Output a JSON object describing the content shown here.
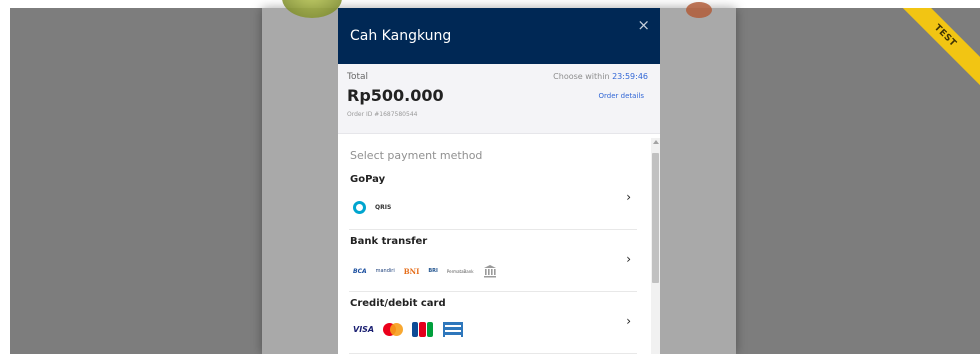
{
  "window": {
    "ribbon_label": "TEST"
  },
  "modal": {
    "merchant_name": "Cah Kangkung",
    "close_glyph": "×"
  },
  "summary": {
    "total_label": "Total",
    "amount": "Rp500.000",
    "order_id": "Order ID #1687580544",
    "countdown_label": "Choose within",
    "countdown_timer": "23:59:46",
    "order_details_label": "Order details"
  },
  "payment": {
    "section_title": "Select payment method",
    "methods": [
      {
        "name": "GoPay",
        "chevron": "›",
        "logos": [
          "gopay-icon",
          "qris-logo"
        ],
        "logo_texts": {
          "qris": "QRIS"
        }
      },
      {
        "name": "Bank transfer",
        "chevron": "›",
        "logos": [
          "bca-logo",
          "mandiri-logo",
          "bni-logo",
          "bri-logo",
          "permata-logo",
          "other-bank-icon"
        ],
        "logo_texts": {
          "bca": "BCA",
          "mandiri": "mandiri",
          "bni": "BNI",
          "bri": "BRI",
          "permata": "PermataBank"
        }
      },
      {
        "name": "Credit/debit card",
        "chevron": "›",
        "logos": [
          "visa-logo",
          "mastercard-icon",
          "jcb-logo",
          "amex-icon"
        ],
        "logo_texts": {
          "visa": "VISA",
          "jcb": "JCB"
        }
      }
    ]
  },
  "colors": {
    "header_bg": "#002855",
    "accent_blue": "#3267d6",
    "ribbon_yellow": "#f2c513",
    "overlay_gray": "#7d7d7d"
  }
}
